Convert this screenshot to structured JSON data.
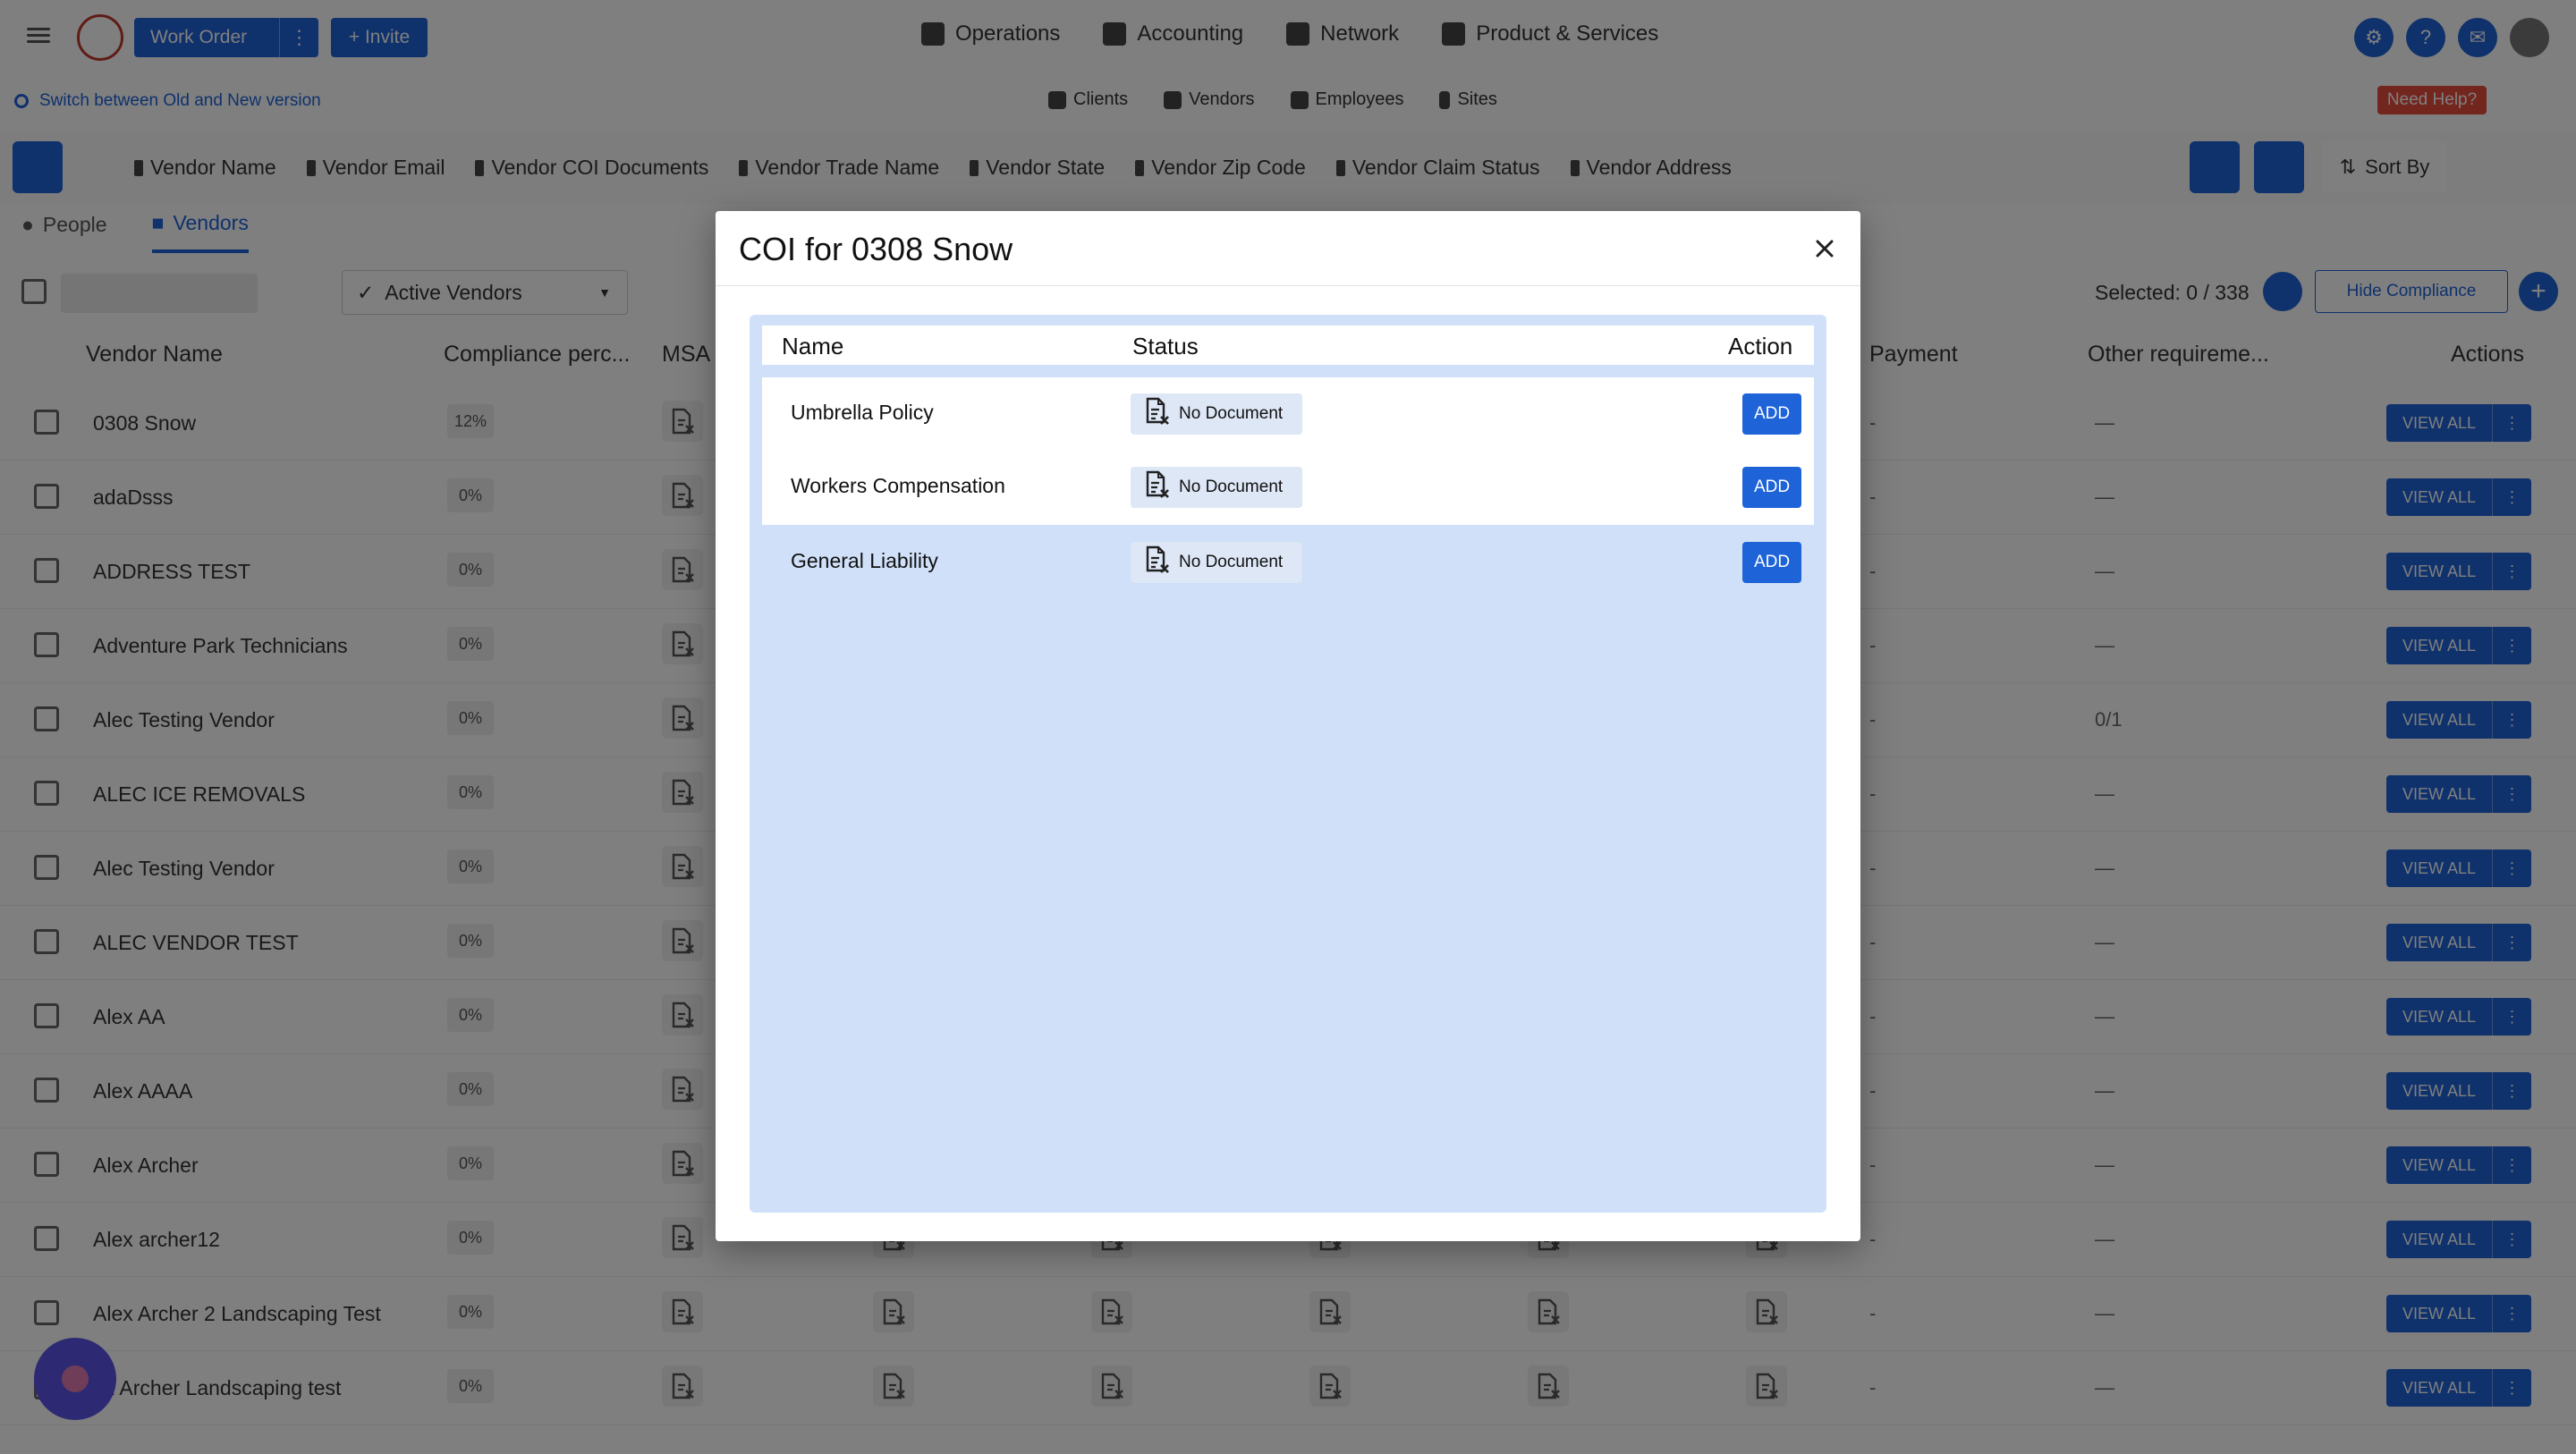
{
  "topnav": {
    "work_order_label": "Work Order",
    "invite_label": "Invite",
    "main_items": [
      {
        "label": "Operations",
        "icon": "clipboard-icon"
      },
      {
        "label": "Accounting",
        "icon": "inbox-icon"
      },
      {
        "label": "Network",
        "icon": "network-icon"
      },
      {
        "label": "Product & Services",
        "icon": "briefcase-icon"
      }
    ]
  },
  "subnav": {
    "switch_label": "Switch between Old and New version",
    "tabs": [
      "Clients",
      "Vendors",
      "Employees",
      "Sites"
    ],
    "help_label": "Need Help?"
  },
  "filterbar": {
    "pinned_filters": [
      "Vendor Name",
      "Vendor Email",
      "Vendor COI Documents",
      "Vendor Trade Name",
      "Vendor State",
      "Vendor Zip Code",
      "Vendor Claim Status",
      "Vendor Address"
    ],
    "sort_label": "Sort By"
  },
  "tabs": {
    "people": "People",
    "vendors": "Vendors"
  },
  "toolbar": {
    "status_filter": "Active Vendors",
    "selected_text": "Selected: 0 / 338",
    "hide_compliance_label": "Hide Compliance"
  },
  "table": {
    "headers": {
      "vendor_name": "Vendor Name",
      "compliance": "Compliance perc...",
      "msa": "MSA",
      "payment": "Payment",
      "other": "Other requireme...",
      "actions": "Actions"
    },
    "view_all_label": "VIEW ALL",
    "rows": [
      {
        "name": "0308 Snow",
        "pct": "12%",
        "payment": "-",
        "other": "—"
      },
      {
        "name": "adaDsss",
        "pct": "0%",
        "payment": "-",
        "other": "—"
      },
      {
        "name": "ADDRESS TEST",
        "pct": "0%",
        "payment": "-",
        "other": "—"
      },
      {
        "name": "Adventure Park Technicians",
        "pct": "0%",
        "payment": "-",
        "other": "—"
      },
      {
        "name": "Alec Testing Vendor",
        "pct": "0%",
        "payment": "-",
        "other": "0/1"
      },
      {
        "name": "ALEC ICE REMOVALS",
        "pct": "0%",
        "payment": "-",
        "other": "—"
      },
      {
        "name": "Alec Testing Vendor",
        "pct": "0%",
        "payment": "-",
        "other": "—"
      },
      {
        "name": "ALEC VENDOR TEST",
        "pct": "0%",
        "payment": "-",
        "other": "—"
      },
      {
        "name": "Alex AA",
        "pct": "0%",
        "payment": "-",
        "other": "—"
      },
      {
        "name": "Alex AAAA",
        "pct": "0%",
        "payment": "-",
        "other": "—"
      },
      {
        "name": "Alex Archer",
        "pct": "0%",
        "payment": "-",
        "other": "—"
      },
      {
        "name": "Alex archer12",
        "pct": "0%",
        "payment": "-",
        "other": "—"
      },
      {
        "name": "Alex Archer 2 Landscaping Test",
        "pct": "0%",
        "payment": "-",
        "other": "—"
      },
      {
        "name": "ex Archer Landscaping test",
        "pct": "0%",
        "payment": "-",
        "other": "—"
      }
    ]
  },
  "modal": {
    "title": "COI for 0308 Snow",
    "headers": {
      "name": "Name",
      "status": "Status",
      "action": "Action"
    },
    "rows": [
      {
        "name": "Umbrella Policy",
        "status": "No Document",
        "action": "ADD"
      },
      {
        "name": "Workers Compensation",
        "status": "No Document",
        "action": "ADD"
      },
      {
        "name": "General Liability",
        "status": "No Document",
        "action": "ADD"
      }
    ]
  },
  "colors": {
    "primary": "#1e63d8",
    "panel_bg": "#cfe0f8",
    "status_chip_bg": "#dde7f6",
    "help_red": "#e74c3c",
    "fab": "#5a54e6"
  }
}
